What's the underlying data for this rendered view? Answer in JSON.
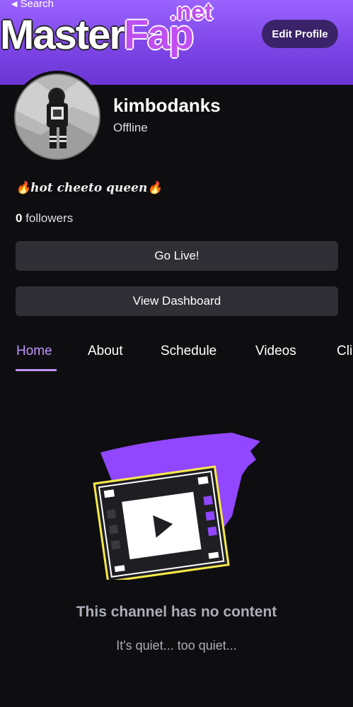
{
  "header": {
    "back_label": "Search",
    "edit_profile_label": "Edit Profile",
    "watermark": {
      "master": "Master",
      "fap": "Fap",
      "net": ".net"
    }
  },
  "profile": {
    "username": "kimbodanks",
    "status": "Offline",
    "bio": "🔥hot cheeto queen🔥",
    "follower_count": "0",
    "followers_label": "followers"
  },
  "actions": {
    "go_live_label": "Go Live!",
    "dashboard_label": "View Dashboard"
  },
  "tabs": [
    {
      "label": "Home",
      "active": true
    },
    {
      "label": "About"
    },
    {
      "label": "Schedule"
    },
    {
      "label": "Videos"
    },
    {
      "label": "Clips"
    }
  ],
  "empty_state": {
    "title": "This channel has no content",
    "subtitle": "It's quiet... too quiet..."
  },
  "colors": {
    "accent": "#bf94ff",
    "banner": "#7d45e6",
    "background": "#0e0e10",
    "button": "#2f2f35"
  }
}
